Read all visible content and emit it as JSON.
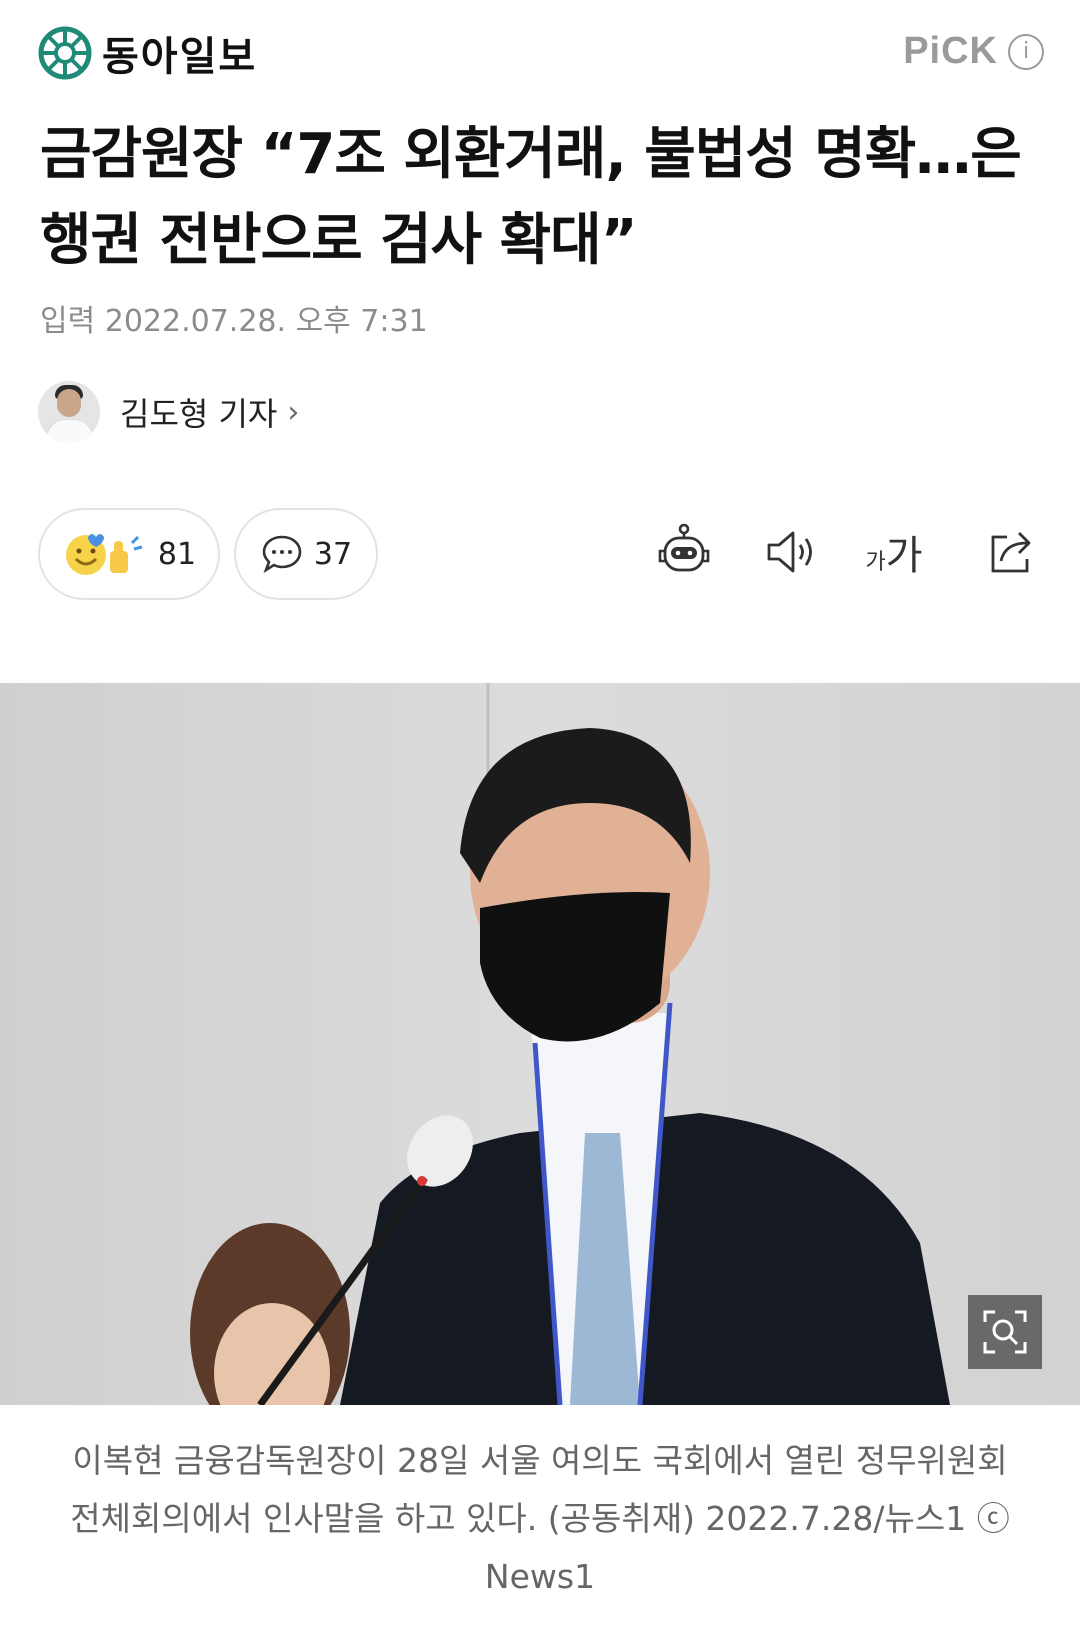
{
  "header": {
    "logo_text": "동아일보",
    "pick_label": "PiCK",
    "info_label": "i"
  },
  "article": {
    "title": "금감원장 “7조 외환거래, 불법성 명확…은행권 전반으로 검사 확대”",
    "date": "입력 2022.07.28. 오후 7:31",
    "reporter": "김도형 기자"
  },
  "actions": {
    "reaction_count": "81",
    "comment_count": "37",
    "tools": [
      "summary-bot-icon",
      "speaker-icon",
      "font-size-icon",
      "share-icon"
    ],
    "font_small": "가",
    "font_big": "가"
  },
  "photo": {
    "caption": "이복현 금융감독원장이 28일 서울 여의도 국회에서 열린 정무위원회 전체회의에서 인사말을 하고 있다. (공동취재) 2022.7.28/뉴스1 ⓒ News1"
  },
  "colors": {
    "logo_green": "#1f8a77",
    "pick_gray": "#9a9a9a",
    "muted_text": "#8c8c8c"
  }
}
